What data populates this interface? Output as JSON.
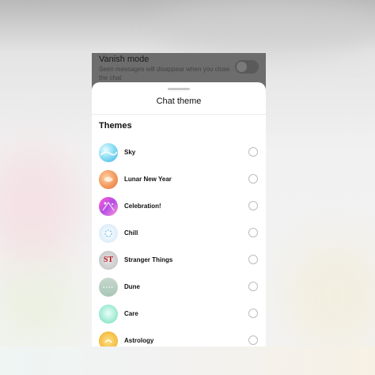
{
  "background_header": {
    "vanish_title": "Vanish mode",
    "vanish_desc": "Seen messages will disappear when you close the chat"
  },
  "sheet": {
    "title": "Chat theme",
    "section_title": "Themes",
    "themes": [
      {
        "label": "Sky",
        "icon": "sky-theme-icon",
        "selected": false
      },
      {
        "label": "Lunar New Year",
        "icon": "lunar-new-year-theme-icon",
        "selected": false
      },
      {
        "label": "Celebration!",
        "icon": "celebration-theme-icon",
        "selected": false
      },
      {
        "label": "Chill",
        "icon": "chill-theme-icon",
        "selected": false
      },
      {
        "label": "Stranger Things",
        "icon": "stranger-things-theme-icon",
        "badge": "ST",
        "selected": false
      },
      {
        "label": "Dune",
        "icon": "dune-theme-icon",
        "selected": false
      },
      {
        "label": "Care",
        "icon": "care-theme-icon",
        "selected": false
      },
      {
        "label": "Astrology",
        "icon": "astrology-theme-icon",
        "selected": false
      }
    ]
  },
  "colors": {
    "sheet_bg": "#ffffff",
    "overlay": "#6d6d6d",
    "radio_border": "#bdbdbd",
    "text": "#111111"
  }
}
